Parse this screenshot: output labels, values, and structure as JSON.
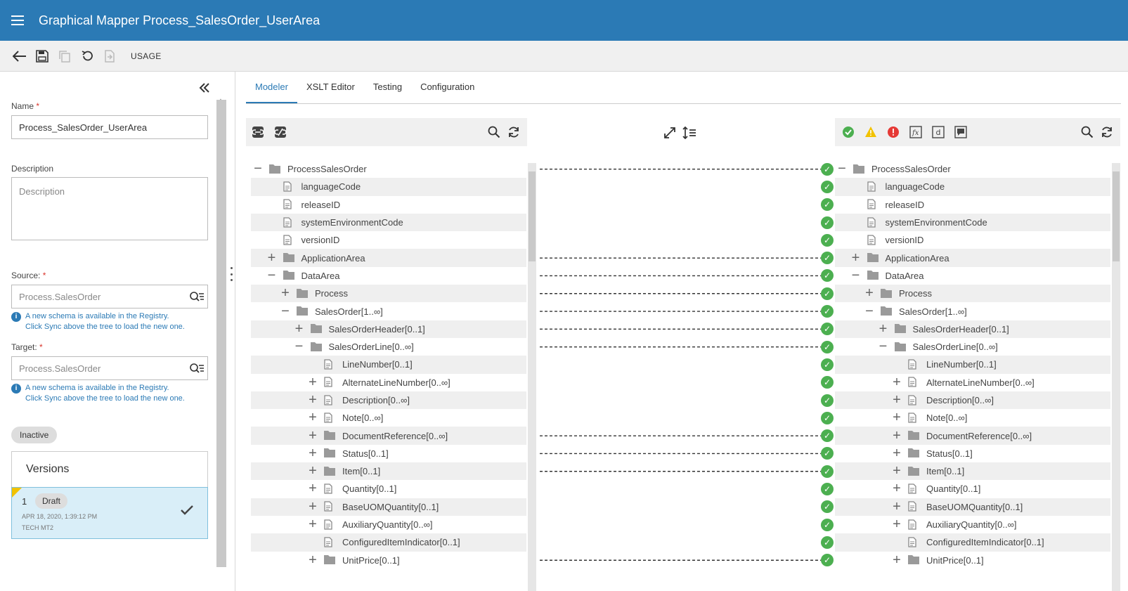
{
  "app": {
    "title": "Graphical Mapper Process_SalesOrder_UserArea"
  },
  "toolbar": {
    "usage_label": "USAGE"
  },
  "left": {
    "name_label": "Name",
    "name_value": "Process_SalesOrder_UserArea",
    "description_label": "Description",
    "description_placeholder": "Description",
    "source_label": "Source:",
    "source_placeholder": "Process.SalesOrder",
    "target_label": "Target:",
    "target_placeholder": "Process.SalesOrder",
    "info_line1": "A new schema is available in the Registry.",
    "info_line2": "Click Sync above the tree to load the new one.",
    "status_pill": "Inactive",
    "versions_title": "Versions",
    "version": {
      "number": "1",
      "badge": "Draft",
      "date": "APR 18, 2020, 1:39:12 PM",
      "user": "TECH MT2"
    }
  },
  "tabs": [
    {
      "label": "Modeler",
      "active": true
    },
    {
      "label": "XSLT Editor",
      "active": false
    },
    {
      "label": "Testing",
      "active": false
    },
    {
      "label": "Configuration",
      "active": false
    }
  ],
  "tree_nodes": [
    {
      "label": "ProcessSalesOrder",
      "kind": "folder",
      "expander": "minus",
      "depth": 0,
      "mapped": true
    },
    {
      "label": "languageCode",
      "kind": "file",
      "expander": "none",
      "depth": 1,
      "mapped": false
    },
    {
      "label": "releaseID",
      "kind": "file",
      "expander": "none",
      "depth": 1,
      "mapped": false
    },
    {
      "label": "systemEnvironmentCode",
      "kind": "file",
      "expander": "none",
      "depth": 1,
      "mapped": false
    },
    {
      "label": "versionID",
      "kind": "file",
      "expander": "none",
      "depth": 1,
      "mapped": false
    },
    {
      "label": "ApplicationArea",
      "kind": "folder",
      "expander": "plus",
      "depth": 1,
      "mapped": true
    },
    {
      "label": "DataArea",
      "kind": "folder",
      "expander": "minus",
      "depth": 1,
      "mapped": true
    },
    {
      "label": "Process",
      "kind": "folder",
      "expander": "plus",
      "depth": 2,
      "mapped": true
    },
    {
      "label": "SalesOrder[1..∞]",
      "kind": "folder",
      "expander": "minus",
      "depth": 2,
      "mapped": true
    },
    {
      "label": "SalesOrderHeader[0..1]",
      "kind": "folder",
      "expander": "plus",
      "depth": 3,
      "mapped": true
    },
    {
      "label": "SalesOrderLine[0..∞]",
      "kind": "folder",
      "expander": "minus",
      "depth": 3,
      "mapped": true
    },
    {
      "label": "LineNumber[0..1]",
      "kind": "file",
      "expander": "none",
      "depth": 4,
      "mapped": false
    },
    {
      "label": "AlternateLineNumber[0..∞]",
      "kind": "file",
      "expander": "plus",
      "depth": 4,
      "mapped": false
    },
    {
      "label": "Description[0..∞]",
      "kind": "file",
      "expander": "plus",
      "depth": 4,
      "mapped": false
    },
    {
      "label": "Note[0..∞]",
      "kind": "file",
      "expander": "plus",
      "depth": 4,
      "mapped": false
    },
    {
      "label": "DocumentReference[0..∞]",
      "kind": "folder",
      "expander": "plus",
      "depth": 4,
      "mapped": true
    },
    {
      "label": "Status[0..1]",
      "kind": "folder",
      "expander": "plus",
      "depth": 4,
      "mapped": true
    },
    {
      "label": "Item[0..1]",
      "kind": "folder",
      "expander": "plus",
      "depth": 4,
      "mapped": true
    },
    {
      "label": "Quantity[0..1]",
      "kind": "file",
      "expander": "plus",
      "depth": 4,
      "mapped": false
    },
    {
      "label": "BaseUOMQuantity[0..1]",
      "kind": "file",
      "expander": "plus",
      "depth": 4,
      "mapped": false
    },
    {
      "label": "AuxiliaryQuantity[0..∞]",
      "kind": "file",
      "expander": "plus",
      "depth": 4,
      "mapped": false
    },
    {
      "label": "ConfiguredItemIndicator[0..1]",
      "kind": "file",
      "expander": "none",
      "depth": 4,
      "mapped": false
    },
    {
      "label": "UnitPrice[0..1]",
      "kind": "folder",
      "expander": "plus",
      "depth": 4,
      "mapped": true
    }
  ],
  "icons": {
    "source_tools": [
      "link-icon",
      "unlink-icon",
      "search-icon",
      "sync-icon"
    ],
    "mid_tools": [
      "expand-icon",
      "line-height-icon"
    ],
    "target_tools": [
      "valid-icon",
      "warning-icon",
      "error-icon",
      "function-icon",
      "default-icon",
      "comment-icon",
      "search-icon",
      "sync-icon"
    ]
  },
  "colors": {
    "appbar": "#2b7ab5",
    "accent": "#2b7ab5",
    "ok": "#4caf50",
    "warning": "#f2c200",
    "error": "#e53935"
  }
}
